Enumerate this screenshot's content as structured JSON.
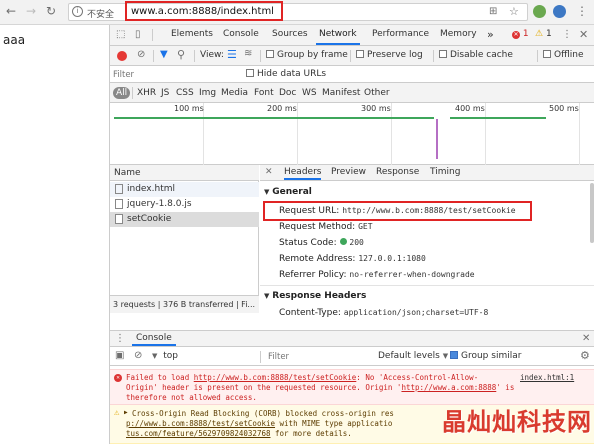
{
  "browser": {
    "insecure_label": "不安全",
    "url": "www.a.com:8888/index.html"
  },
  "page": {
    "text": "aaa"
  },
  "devtools": {
    "tabs": [
      "Elements",
      "Console",
      "Sources",
      "Network",
      "Performance",
      "Memory"
    ],
    "more_tabs": "»",
    "error_count": "1",
    "warn_count": "1",
    "toolbar": {
      "view_label": "View:",
      "group_by_frame": "Group by frame",
      "preserve_log": "Preserve log",
      "disable_cache": "Disable cache",
      "offline": "Offline"
    },
    "filter": {
      "placeholder": "Filter",
      "hide_data_urls": "Hide data URLs",
      "types": [
        "All",
        "XHR",
        "JS",
        "CSS",
        "Img",
        "Media",
        "Font",
        "Doc",
        "WS",
        "Manifest",
        "Other"
      ]
    },
    "timeline_ticks": [
      "100 ms",
      "200 ms",
      "300 ms",
      "400 ms",
      "500 ms"
    ],
    "requests": {
      "header": "Name",
      "items": [
        "index.html",
        "jquery-1.8.0.js",
        "setCookie"
      ],
      "status": "3 requests | 376 B transferred | Fi..."
    },
    "detail_tabs": [
      "Headers",
      "Preview",
      "Response",
      "Timing"
    ],
    "general": {
      "title": "General",
      "request_url_label": "Request URL:",
      "request_url": "http://www.b.com:8888/test/setCookie",
      "method_label": "Request Method:",
      "method": "GET",
      "status_label": "Status Code:",
      "status": "200",
      "remote_label": "Remote Address:",
      "remote": "127.0.0.1:1080",
      "referrer_label": "Referrer Policy:",
      "referrer": "no-referrer-when-downgrade"
    },
    "response_headers": {
      "title": "Response Headers",
      "content_type_label": "Content-Type:",
      "content_type": "application/json;charset=UTF-8"
    },
    "console": {
      "tab": "Console",
      "context": "top",
      "filter_placeholder": "Filter",
      "levels": "Default levels",
      "group_similar": "Group similar",
      "error": {
        "l1a": "Failed to load ",
        "l1url": "http://www.b.com:8888/test/setCookie",
        "l1b": ": No 'Access-Control-Allow-",
        "l1src": "index.html:1",
        "l2a": "Origin' header is present on the requested resource. Origin '",
        "l2url": "http://www.a.com:8888",
        "l2b": "' is",
        "l3": "therefore not allowed access."
      },
      "warning": {
        "l1": "Cross-Origin Read Blocking (CORB) blocked cross-origin res",
        "l2a": "p://www.b.com:8888/test/setCookie",
        "l2b": " with MIME type applicatio",
        "l3a": "tus.com/feature/5629709824032768",
        "l3b": " for more details."
      }
    }
  },
  "watermark": "晶灿灿科技网",
  "colors": {
    "highlight": "#e02424",
    "accent": "#1a73e8",
    "error_bg": "#fff0f0",
    "warn_bg": "#fffbe6"
  }
}
